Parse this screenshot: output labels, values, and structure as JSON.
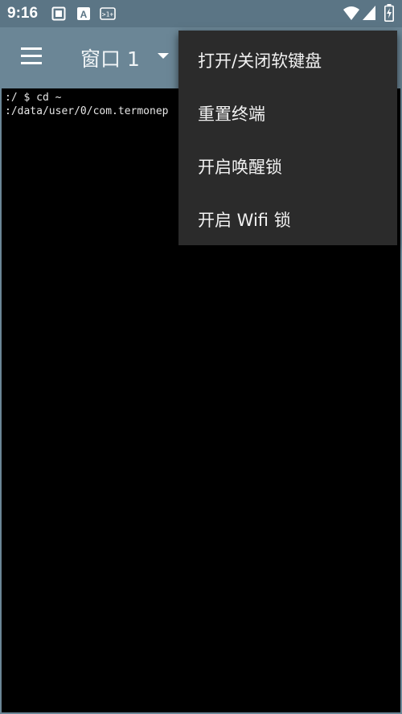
{
  "status_bar": {
    "time": "9:16",
    "icons": [
      "sd-card-icon",
      "a-icon",
      "keyboard-shortcut-icon",
      "wifi-icon",
      "signal-icon",
      "battery-charging-icon"
    ],
    "shortcut_badge": ">1+",
    "a_badge": "A"
  },
  "app_bar": {
    "menu_icon": "hamburger-icon",
    "title": "窗口 1",
    "dropdown_icon": "caret-down-icon",
    "color": "#6b8696"
  },
  "terminal": {
    "lines": [
      ":/ $ cd ~",
      ":/data/user/0/com.termonep"
    ]
  },
  "overflow_menu": {
    "items": [
      {
        "label": "打开/关闭软键盘"
      },
      {
        "label": "重置终端"
      },
      {
        "label": "开启唤醒锁"
      },
      {
        "label": "开启 Wifi 锁"
      }
    ]
  }
}
